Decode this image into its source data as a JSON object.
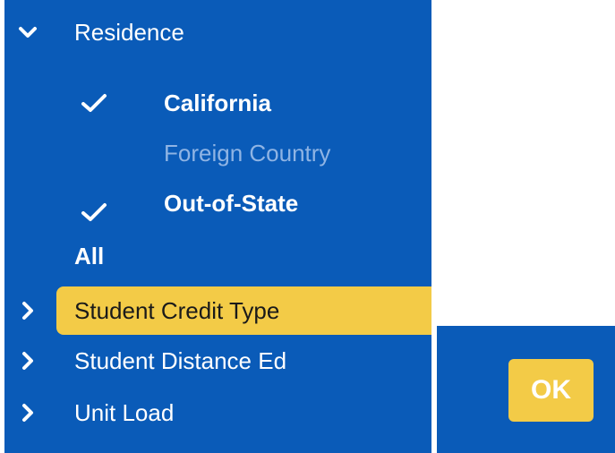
{
  "colors": {
    "panel_bg": "#0a5bb8",
    "highlight": "#f3cb47",
    "text": "#ffffff",
    "dimmed_text": "#8fb4e4"
  },
  "filters": {
    "residence": {
      "label": "Residence",
      "expanded": true,
      "options": [
        {
          "label": "California",
          "checked": true,
          "enabled": true
        },
        {
          "label": "Foreign Country",
          "checked": false,
          "enabled": false
        },
        {
          "label": "Out-of-State",
          "checked": true,
          "enabled": true
        }
      ],
      "all_label": "All"
    },
    "student_credit_type": {
      "label": "Student Credit Type",
      "expanded": false,
      "highlighted": true
    },
    "student_distance_ed": {
      "label": "Student Distance Ed",
      "expanded": false
    },
    "unit_load": {
      "label": "Unit Load",
      "expanded": false
    }
  },
  "actions": {
    "ok_label": "OK"
  },
  "icons": {
    "expanded": "chevron-down-icon",
    "collapsed": "chevron-right-icon",
    "selected": "checkmark-icon"
  }
}
